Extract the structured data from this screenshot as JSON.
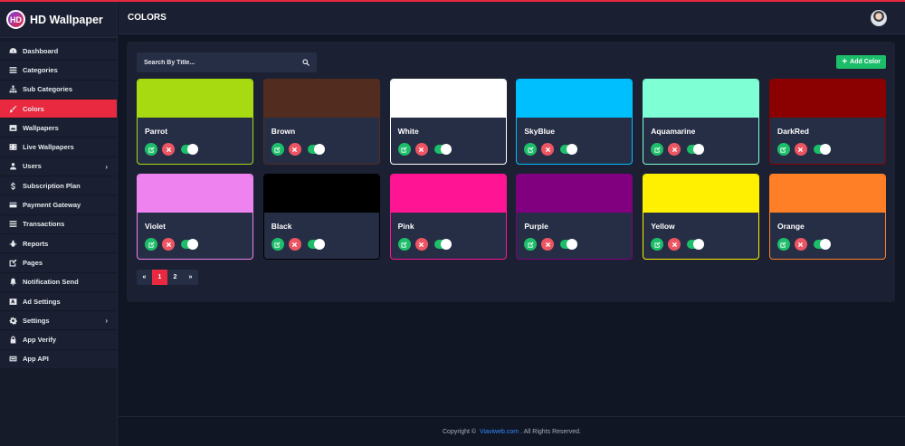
{
  "app": {
    "title": "HD Wallpaper",
    "logo_text": "HD"
  },
  "header": {
    "title": "COLORS"
  },
  "sidebar": {
    "items": [
      {
        "label": "Dashboard",
        "icon": "dashboard-icon"
      },
      {
        "label": "Categories",
        "icon": "list-icon"
      },
      {
        "label": "Sub Categories",
        "icon": "sitemap-icon"
      },
      {
        "label": "Colors",
        "icon": "brush-icon",
        "active": true
      },
      {
        "label": "Wallpapers",
        "icon": "image-icon"
      },
      {
        "label": "Live Wallpapers",
        "icon": "film-icon"
      },
      {
        "label": "Users",
        "icon": "users-icon",
        "has_submenu": true
      },
      {
        "label": "Subscription Plan",
        "icon": "dollar-icon"
      },
      {
        "label": "Payment Gateway",
        "icon": "credit-card-icon"
      },
      {
        "label": "Transactions",
        "icon": "list-icon"
      },
      {
        "label": "Reports",
        "icon": "bug-icon"
      },
      {
        "label": "Pages",
        "icon": "edit-icon"
      },
      {
        "label": "Notification Send",
        "icon": "bell-icon"
      },
      {
        "label": "Ad Settings",
        "icon": "ad-icon"
      },
      {
        "label": "Settings",
        "icon": "gear-icon",
        "has_submenu": true
      },
      {
        "label": "App Verify",
        "icon": "lock-icon"
      },
      {
        "label": "App API",
        "icon": "api-icon"
      }
    ]
  },
  "search": {
    "placeholder": "Search By Title..."
  },
  "toolbar": {
    "add_label": "Add Color"
  },
  "colors": [
    {
      "name": "Parrot",
      "hex": "#a8da11",
      "border": "#a8da11",
      "enabled": true
    },
    {
      "name": "Brown",
      "hex": "#532c20",
      "border": "#532c20",
      "enabled": true
    },
    {
      "name": "White",
      "hex": "#ffffff",
      "border": "#ffffff",
      "enabled": true
    },
    {
      "name": "SkyBlue",
      "hex": "#00bfff",
      "border": "#00bfff",
      "enabled": true
    },
    {
      "name": "Aquamarine",
      "hex": "#7fffd4",
      "border": "#7fffd4",
      "enabled": true
    },
    {
      "name": "DarkRed",
      "hex": "#8b0000",
      "border": "#8b0000",
      "enabled": true
    },
    {
      "name": "Violet",
      "hex": "#ee82ee",
      "border": "#ee82ee",
      "enabled": true
    },
    {
      "name": "Black",
      "hex": "#000000",
      "border": "#000000",
      "enabled": true
    },
    {
      "name": "Pink",
      "hex": "#ff1493",
      "border": "#ff1493",
      "enabled": true
    },
    {
      "name": "Purple",
      "hex": "#800080",
      "border": "#800080",
      "enabled": true
    },
    {
      "name": "Yellow",
      "hex": "#ffef00",
      "border": "#ffef00",
      "enabled": true
    },
    {
      "name": "Orange",
      "hex": "#ff7f27",
      "border": "#ff7f27",
      "enabled": true
    }
  ],
  "pagination": {
    "prev": "«",
    "pages": [
      "1",
      "2"
    ],
    "current": "1",
    "next": "»"
  },
  "footer": {
    "prefix": "Copyright ©",
    "link": "Viaviweb.com",
    "suffix": ". All Rights Reserved."
  },
  "theme": {
    "accent": "#e8293f",
    "success": "#1dbe6a",
    "danger": "#ee5562"
  }
}
